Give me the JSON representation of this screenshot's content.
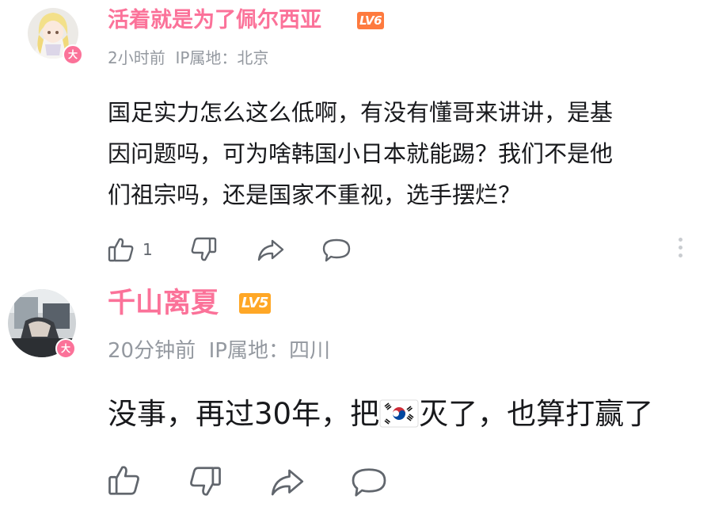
{
  "comments": [
    {
      "username": "活着就是为了佩尔西亚",
      "level": "LV6",
      "level_color": "#fe7a3e",
      "avatar_badge": "大",
      "time": "2小时前",
      "ip": "IP属地：北京",
      "lines": [
        "国足实力怎么这么低啊，有没有懂哥来讲讲，是基",
        "因问题吗，可为啥韩国小日本就能踢？我们不是他",
        "们祖宗吗，还是国家不重视，选手摆烂？"
      ],
      "like_count": "1",
      "icons": [
        "thumbs-up-icon",
        "thumbs-down-icon",
        "share-icon",
        "reply-icon",
        "more-icon"
      ]
    },
    {
      "username": "千山离夏",
      "level": "LV5",
      "level_color": "#ffa726",
      "avatar_badge": "大",
      "time": "20分钟前",
      "ip": "IP属地：四川",
      "text_before": "没事，再过30年，把",
      "text_flag_icon": "south-korea-flag-icon",
      "text_after": "灭了，也算打赢了",
      "icons": [
        "thumbs-up-icon",
        "thumbs-down-icon",
        "share-icon",
        "reply-icon"
      ]
    }
  ],
  "colors": {
    "username": "#fb7299",
    "meta": "#9499a0",
    "body": "#18191c",
    "icon": "#61666d"
  }
}
